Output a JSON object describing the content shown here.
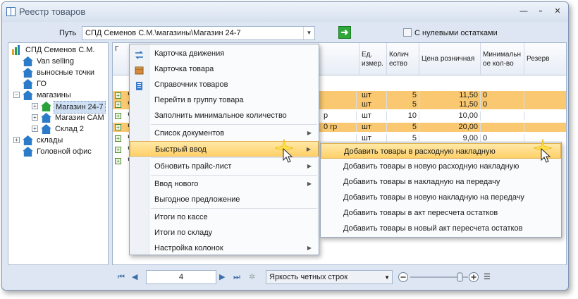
{
  "window": {
    "title": "Реестр товаров"
  },
  "toolbar": {
    "path_label": "Путь",
    "path_value": "СПД Семенов С.М.\\магазины\\Магазин 24-7",
    "zero_stock_label": "С нулевыми остатками"
  },
  "tree": [
    {
      "label": "СПД Семенов С.М.",
      "depth": 0,
      "icon": "chart-icon",
      "exp": ""
    },
    {
      "label": "Van selling",
      "depth": 1,
      "icon": "house-icon",
      "exp": ""
    },
    {
      "label": "выносные точки",
      "depth": 1,
      "icon": "house-icon",
      "exp": ""
    },
    {
      "label": "ГО",
      "depth": 1,
      "icon": "house-icon",
      "exp": ""
    },
    {
      "label": "магазины",
      "depth": 1,
      "icon": "house-icon",
      "exp": "−"
    },
    {
      "label": "Магазин 24-7",
      "depth": 2,
      "icon": "house-green-icon",
      "exp": "+",
      "sel": true
    },
    {
      "label": "Магазин САМ",
      "depth": 2,
      "icon": "house-icon",
      "exp": "+"
    },
    {
      "label": "Склад 2",
      "depth": 2,
      "icon": "house-icon",
      "exp": "+"
    },
    {
      "label": "склады",
      "depth": 1,
      "icon": "house-icon",
      "exp": "+"
    },
    {
      "label": "Головной офис",
      "depth": 1,
      "icon": "house-icon",
      "exp": ""
    }
  ],
  "grid": {
    "headers": [
      {
        "key": "name",
        "label": "Г"
      },
      {
        "key": "unit",
        "label": "Ед. измер."
      },
      {
        "key": "qty",
        "label": "Колич ество"
      },
      {
        "key": "price",
        "label": "Цена розничная"
      },
      {
        "key": "min",
        "label": "Минимальн ое кол-во"
      },
      {
        "key": "reserve",
        "label": "Резерв"
      }
    ],
    "rows": [
      {
        "name": "Ч",
        "extra": "",
        "unit": "шт",
        "qty": "5",
        "price": "11,50",
        "min": "0",
        "hl": true
      },
      {
        "name": "Ч",
        "extra": "",
        "unit": "шт",
        "qty": "5",
        "price": "11,50",
        "min": "0",
        "hl": true
      },
      {
        "name": "Ч",
        "extra": "р",
        "unit": "шт",
        "qty": "10",
        "price": "10,00",
        "min": "",
        "hl": false
      },
      {
        "name": "Ч",
        "extra": "0 гр",
        "unit": "шт",
        "qty": "5",
        "price": "20,00",
        "min": "",
        "hl": true
      },
      {
        "name": "Ч",
        "extra": "",
        "unit": "шт",
        "qty": "5",
        "price": "9,00",
        "min": "0",
        "hl": false
      },
      {
        "name": "Ч",
        "extra": "",
        "unit": "",
        "qty": "",
        "price": "",
        "min": "",
        "hl": false
      },
      {
        "name": "Ч",
        "extra": "",
        "unit": "",
        "qty": "",
        "price": "",
        "min": "",
        "hl": false
      }
    ]
  },
  "pager": {
    "page": "4",
    "row_brightness": "Яркость четных строк"
  },
  "context_menu": [
    {
      "label": "Карточка движения",
      "icon": "movement-card-icon",
      "sep_before": false,
      "arrow": false
    },
    {
      "label": "Карточка товара",
      "icon": "product-box-icon",
      "sep_before": false,
      "arrow": false
    },
    {
      "label": "Справочник товаров",
      "icon": "catalog-icon",
      "sep_before": false,
      "arrow": false
    },
    {
      "label": "Перейти в группу товара",
      "icon": "",
      "sep_before": false,
      "arrow": false
    },
    {
      "label": "Заполнить минимальное количество",
      "icon": "",
      "sep_before": false,
      "arrow": false
    },
    {
      "label": "Список документов",
      "icon": "",
      "sep_before": true,
      "arrow": true
    },
    {
      "label": "Быстрый ввод",
      "icon": "",
      "sep_before": false,
      "arrow": true,
      "active": true
    },
    {
      "label": "Обновить прайс-лист",
      "icon": "",
      "sep_before": true,
      "arrow": true
    },
    {
      "label": "Ввод нового",
      "icon": "",
      "sep_before": true,
      "arrow": true
    },
    {
      "label": "Выгодное предложение",
      "icon": "",
      "sep_before": false,
      "arrow": false
    },
    {
      "label": "Итоги по кассе",
      "icon": "",
      "sep_before": true,
      "arrow": false
    },
    {
      "label": "Итоги по складу",
      "icon": "",
      "sep_before": false,
      "arrow": false
    },
    {
      "label": "Настройка колонок",
      "icon": "",
      "sep_before": false,
      "arrow": true
    }
  ],
  "submenu": [
    {
      "label": "Добавить товары в расходную накладную",
      "active": true
    },
    {
      "label": "Добавить товары в новую расходную накладную"
    },
    {
      "label": "Добавить товары в накладную на передачу"
    },
    {
      "label": "Добавить товары в новую накладную на передачу"
    },
    {
      "label": "Добавить товары в акт пересчета остатков"
    },
    {
      "label": "Добавить товары в новый акт пересчета остатков"
    }
  ],
  "colors": {
    "highlight_row": "#f9c870",
    "menu_active": "#ffd068",
    "accent": "#2b7bc9"
  }
}
